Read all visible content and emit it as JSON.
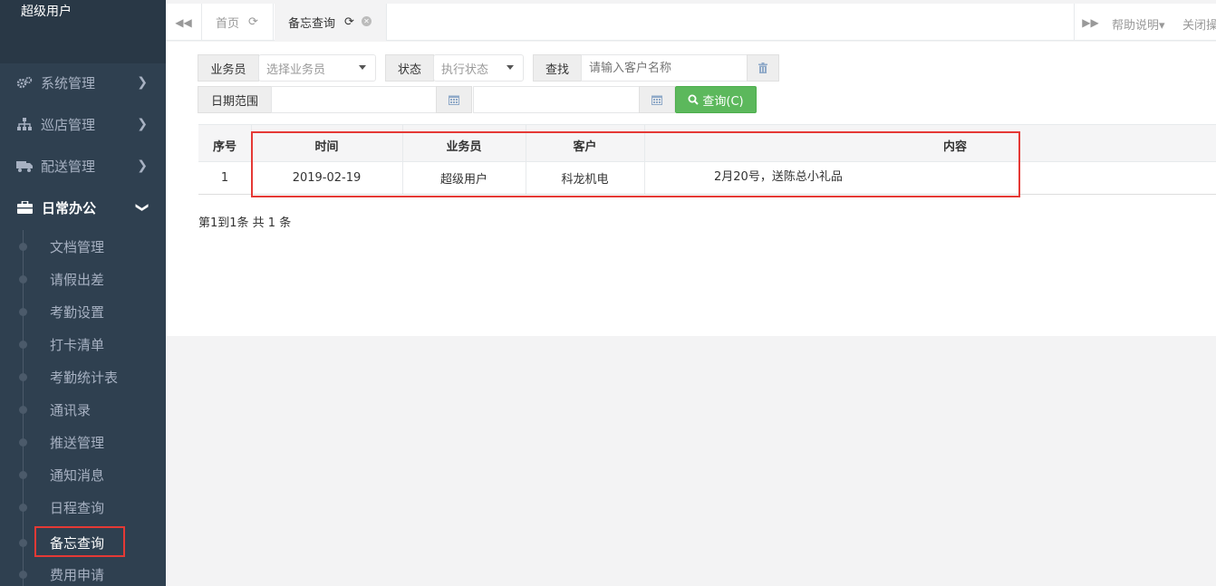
{
  "sidebar": {
    "username": "超级用户",
    "menu": [
      {
        "label": "系统管理",
        "icon": "gears-icon"
      },
      {
        "label": "巡店管理",
        "icon": "sitemap-icon"
      },
      {
        "label": "配送管理",
        "icon": "truck-icon"
      },
      {
        "label": "日常办公",
        "icon": "briefcase-icon"
      }
    ],
    "submenu": [
      {
        "label": "文档管理"
      },
      {
        "label": "请假出差"
      },
      {
        "label": "考勤设置"
      },
      {
        "label": "打卡清单"
      },
      {
        "label": "考勤统计表"
      },
      {
        "label": "通讯录"
      },
      {
        "label": "推送管理"
      },
      {
        "label": "通知消息"
      },
      {
        "label": "日程查询"
      },
      {
        "label": "备忘查询"
      },
      {
        "label": "费用申请"
      }
    ]
  },
  "tabs": {
    "home": "首页",
    "current": "备忘查询",
    "help": "帮助说明",
    "close_ops": "关闭操作"
  },
  "filters": {
    "salesman_label": "业务员",
    "salesman_placeholder": "选择业务员",
    "status_label": "状态",
    "status_placeholder": "执行状态",
    "search_label": "查找",
    "search_placeholder": "请输入客户名称",
    "date_label": "日期范围",
    "query_button": "查询(C)"
  },
  "table": {
    "headers": [
      "序号",
      "时间",
      "业务员",
      "客户",
      "内容"
    ],
    "rows": [
      [
        "1",
        "2019-02-19",
        "超级用户",
        "科龙机电",
        "2月20号，送陈总小礼品"
      ]
    ]
  },
  "pagination": "第1到1条 共 1 条",
  "colors": {
    "sidebar_bg": "#2f4050",
    "accent_green": "#5cb85c",
    "highlight_red": "#e53935"
  }
}
